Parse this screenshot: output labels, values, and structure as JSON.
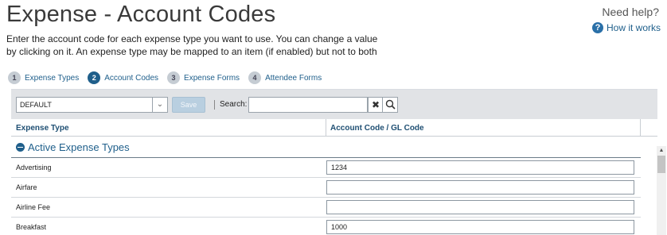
{
  "page": {
    "title": "Expense - Account Codes",
    "instructions": "Enter the account code for each expense type you want to use. You can change a value by clicking on it. An expense type may be mapped to an item (if enabled) but not to both"
  },
  "help": {
    "title": "Need help?",
    "link_icon": "question-circle-icon",
    "link_label": "How it works"
  },
  "steps": [
    {
      "num": "1",
      "label": "Expense Types",
      "active": false
    },
    {
      "num": "2",
      "label": "Account Codes",
      "active": true
    },
    {
      "num": "3",
      "label": "Expense Forms",
      "active": false
    },
    {
      "num": "4",
      "label": "Attendee Forms",
      "active": false
    }
  ],
  "toolbar": {
    "select_value": "DEFAULT",
    "save_label": "Save",
    "search_label": "Search:",
    "search_value": "",
    "clear_icon": "close-icon",
    "search_icon": "magnifier-icon"
  },
  "grid": {
    "columns": [
      "Expense Type",
      "Account Code / GL Code"
    ],
    "group_label": "Active Expense Types",
    "rows": [
      {
        "name": "Advertising",
        "code": "1234"
      },
      {
        "name": "Airfare",
        "code": ""
      },
      {
        "name": "Airline Fee",
        "code": ""
      },
      {
        "name": "Breakfast",
        "code": "1000"
      }
    ]
  },
  "colors": {
    "accent": "#1f5f8b",
    "toolbar_bg": "#e1e3e6",
    "save_disabled": "#b9cfe0"
  }
}
